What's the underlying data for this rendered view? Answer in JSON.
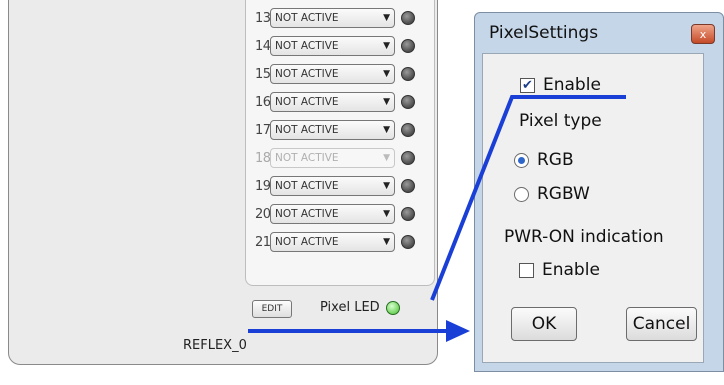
{
  "panel": {
    "title": "REFLEX_0",
    "rows": [
      {
        "num": "13",
        "value": "NOT ACTIVE",
        "enabled": true
      },
      {
        "num": "14",
        "value": "NOT ACTIVE",
        "enabled": true
      },
      {
        "num": "15",
        "value": "NOT ACTIVE",
        "enabled": true
      },
      {
        "num": "16",
        "value": "NOT ACTIVE",
        "enabled": true
      },
      {
        "num": "17",
        "value": "NOT ACTIVE",
        "enabled": true
      },
      {
        "num": "18",
        "value": "NOT ACTIVE",
        "enabled": false
      },
      {
        "num": "19",
        "value": "NOT ACTIVE",
        "enabled": true
      },
      {
        "num": "20",
        "value": "NOT ACTIVE",
        "enabled": true
      },
      {
        "num": "21",
        "value": "NOT ACTIVE",
        "enabled": true
      }
    ],
    "edit_label": "EDIT",
    "pixel_led_label": "Pixel LED"
  },
  "dialog": {
    "title": "PixelSettings",
    "close_icon": "x",
    "enable_label": "Enable",
    "enable_checked": true,
    "pixel_type_label": "Pixel type",
    "rgb_label": "RGB",
    "rgbw_label": "RGBW",
    "rgb_selected": true,
    "pwr_on_label": "PWR-ON indication",
    "pwr_enable_label": "Enable",
    "pwr_enable_checked": false,
    "ok_label": "OK",
    "cancel_label": "Cancel"
  },
  "colors": {
    "annotation_line": "#1a3fd6",
    "led_green": "#6fd35c",
    "led_gray": "#4d4d4d"
  }
}
